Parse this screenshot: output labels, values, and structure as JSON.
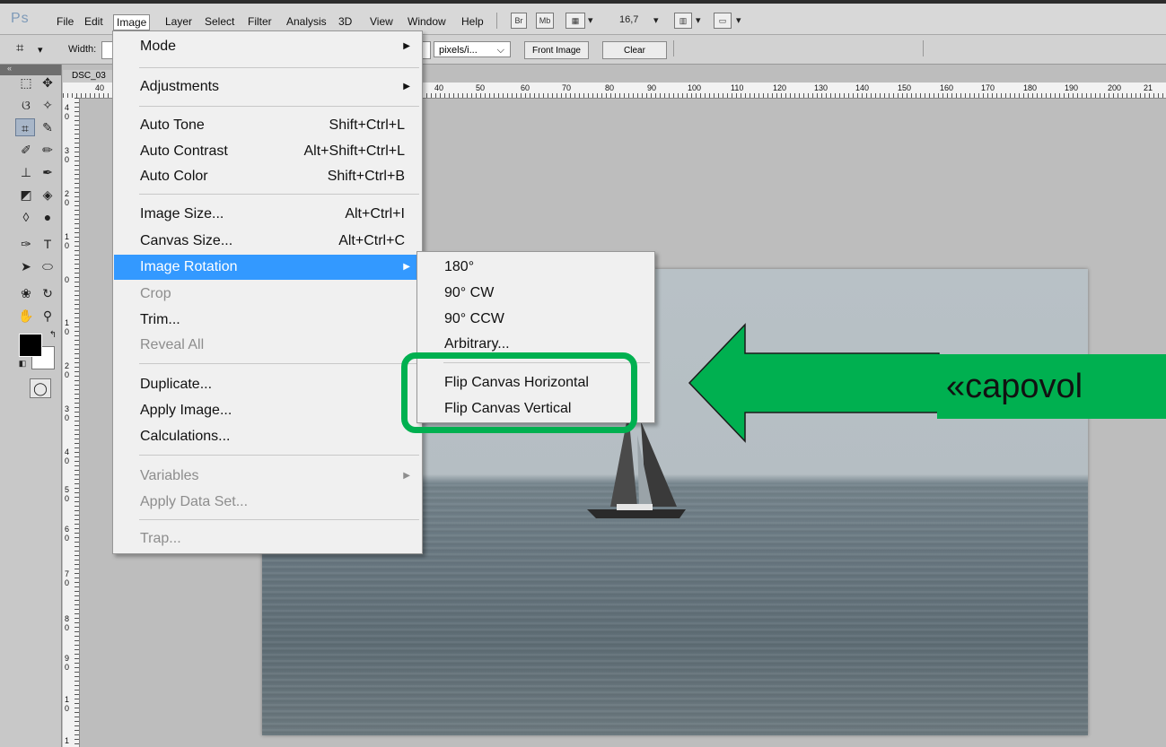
{
  "menubar": {
    "logo": "Ps",
    "items": [
      "File",
      "Edit",
      "Image",
      "Layer",
      "Select",
      "Filter",
      "Analysis",
      "3D",
      "View",
      "Window",
      "Help"
    ],
    "active_item": "Image",
    "bridge_btn": "Br",
    "minibridge_btn": "Mb",
    "zoom_value": "16,7"
  },
  "options": {
    "width_label": "Width:",
    "resolution_unit": "pixels/i...",
    "front_image_btn": "Front Image",
    "clear_btn": "Clear"
  },
  "document": {
    "tab_label": "DSC_03",
    "ruler_top_labels": [
      "40",
      "40",
      "50",
      "60",
      "70",
      "80",
      "90",
      "100",
      "110",
      "120",
      "130",
      "140",
      "150",
      "160",
      "170",
      "180",
      "190",
      "200",
      "21"
    ],
    "ruler_left_labels": [
      "4\n0",
      "3\n0",
      "2\n0",
      "1\n0",
      "0",
      "1\n0",
      "2\n0",
      "3\n0",
      "4\n0",
      "5\n0",
      "6\n0",
      "7\n0",
      "8\n0",
      "9\n0",
      "1\n0",
      "1"
    ]
  },
  "image_menu": {
    "mode": "Mode",
    "adjustments": "Adjustments",
    "auto_tone": "Auto Tone",
    "auto_tone_sc": "Shift+Ctrl+L",
    "auto_contrast": "Auto Contrast",
    "auto_contrast_sc": "Alt+Shift+Ctrl+L",
    "auto_color": "Auto Color",
    "auto_color_sc": "Shift+Ctrl+B",
    "image_size": "Image Size...",
    "image_size_sc": "Alt+Ctrl+I",
    "canvas_size": "Canvas Size...",
    "canvas_size_sc": "Alt+Ctrl+C",
    "image_rotation": "Image Rotation",
    "crop": "Crop",
    "trim": "Trim...",
    "reveal_all": "Reveal All",
    "duplicate": "Duplicate...",
    "apply_image": "Apply Image...",
    "calculations": "Calculations...",
    "variables": "Variables",
    "apply_data_set": "Apply Data Set...",
    "trap": "Trap..."
  },
  "rotation_submenu": {
    "r180": "180°",
    "r90cw": "90° CW",
    "r90ccw": "90° CCW",
    "arbitrary": "Arbitrary...",
    "flip_h": "Flip Canvas Horizontal",
    "flip_v": "Flip Canvas Vertical"
  },
  "annotation": {
    "text": "«capovol",
    "color": "#00b050"
  }
}
